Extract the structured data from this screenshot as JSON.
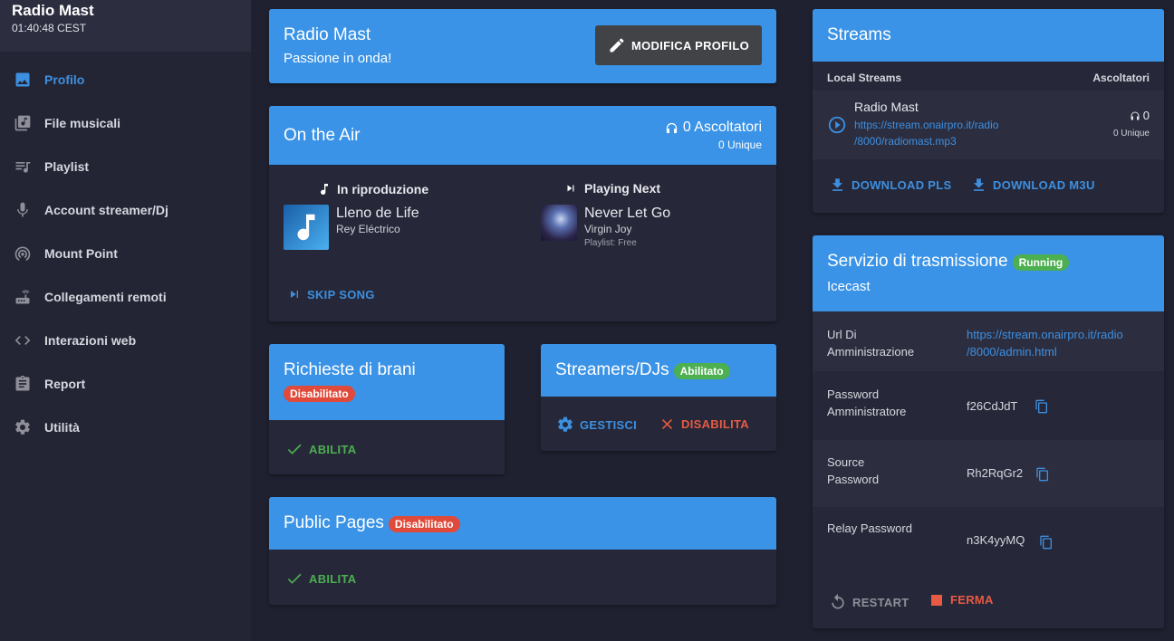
{
  "app": {
    "title": "Radio Mast",
    "time": "01:40:48 CEST"
  },
  "sidebar": {
    "items": [
      {
        "label": "Profilo",
        "icon": "image-icon"
      },
      {
        "label": "File musicali",
        "icon": "music-library-icon"
      },
      {
        "label": "Playlist",
        "icon": "playlist-icon"
      },
      {
        "label": "Account streamer/Dj",
        "icon": "microphone-icon"
      },
      {
        "label": "Mount Point",
        "icon": "broadcast-icon"
      },
      {
        "label": "Collegamenti remoti",
        "icon": "router-icon"
      },
      {
        "label": "Interazioni web",
        "icon": "code-icon"
      },
      {
        "label": "Report",
        "icon": "clipboard-icon"
      },
      {
        "label": "Utilità",
        "icon": "gear-icon"
      }
    ]
  },
  "profile": {
    "name": "Radio Mast",
    "tagline": "Passione in onda!",
    "edit_label": "MODIFICA PROFILO"
  },
  "on_air": {
    "title": "On the Air",
    "listeners": "0 Ascoltatori",
    "unique": "0 Unique",
    "now_playing": {
      "label": "In riproduzione",
      "title": "Lleno de Life",
      "artist": "Rey Eléctrico"
    },
    "next": {
      "label": "Playing Next",
      "title": "Never Let Go",
      "artist": "Virgin Joy",
      "playlist": "Playlist: Free"
    },
    "skip_label": "SKIP SONG"
  },
  "requests": {
    "title": "Richieste di brani",
    "badge": "Disabilitato",
    "action": "ABILITA"
  },
  "streamers": {
    "title": "Streamers/DJs",
    "badge": "Abilitato",
    "manage": "GESTISCI",
    "disable": "DISABILITA"
  },
  "public_pages": {
    "title": "Public Pages",
    "badge": "Disabilitato",
    "action": "ABILITA"
  },
  "streams": {
    "title": "Streams",
    "col_left": "Local Streams",
    "col_right": "Ascoltatori",
    "item": {
      "name": "Radio Mast",
      "url_line1": "https://stream.onairpro.it/radio",
      "url_line2": "/8000/radiomast.mp3",
      "count": "0",
      "unique": "0 Unique"
    },
    "download_pls": "DOWNLOAD PLS",
    "download_m3u": "DOWNLOAD M3U"
  },
  "broadcast": {
    "title": "Servizio di trasmissione",
    "status": "Running",
    "server": "Icecast",
    "rows": [
      {
        "label1": "Url Di",
        "label2": "Amministrazione",
        "value1": "https://stream.onairpro.it/radio",
        "value2": "/8000/admin.html"
      },
      {
        "label1": "Password",
        "label2": "Amministratore",
        "value": "f26CdJdT"
      },
      {
        "label1": "Source",
        "label2": "Password",
        "value": "Rh2RqGr2"
      },
      {
        "label1": "Relay Password",
        "value": "n3K4yyMQ"
      }
    ],
    "restart": "RESTART",
    "stop": "FERMA"
  },
  "colors": {
    "accent": "#3a93e6",
    "background": "#1f2130",
    "card": "#262839",
    "success": "#4caf50",
    "danger": "#e04a3b"
  }
}
